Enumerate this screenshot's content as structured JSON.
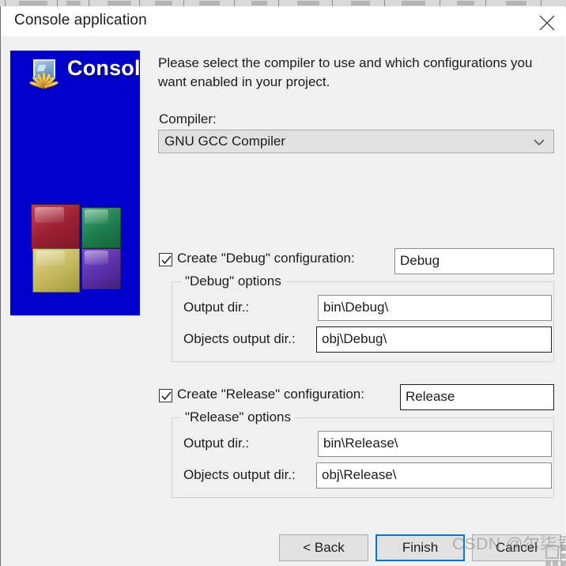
{
  "window": {
    "title": "Console application",
    "close_icon": "close-icon"
  },
  "banner": {
    "title": "Console",
    "icon": "console-picture-fan-icon",
    "background_color": "#0000CC",
    "cubes": [
      {
        "name": "red-cube",
        "color": "#9C1F32"
      },
      {
        "name": "green-cube",
        "color": "#1E7D4C"
      },
      {
        "name": "yellow-cube",
        "color": "#C4B85C"
      },
      {
        "name": "purple-cube",
        "color": "#5A2EA8"
      }
    ]
  },
  "main": {
    "intro": "Please select the compiler to use and which configurations you want enabled in your project.",
    "compiler": {
      "label": "Compiler:",
      "selected": "GNU GCC Compiler",
      "arrow_icon": "chevron-down-icon"
    },
    "debug": {
      "checkbox_checked": true,
      "check_icon": "checkmark-icon",
      "caption": "Create \"Debug\" configuration:",
      "name_value": "Debug",
      "group_title": "\"Debug\" options",
      "output_dir_label": "Output dir.:",
      "output_dir_value": "bin\\Debug\\",
      "objects_dir_label": "Objects output dir.:",
      "objects_dir_value": "obj\\Debug\\"
    },
    "release": {
      "checkbox_checked": true,
      "check_icon": "checkmark-icon",
      "caption": "Create \"Release\" configuration:",
      "name_value": "Release",
      "group_title": "\"Release\" options",
      "output_dir_label": "Output dir.:",
      "output_dir_value": "bin\\Release\\",
      "objects_dir_label": "Objects output dir.:",
      "objects_dir_value": "obj\\Release\\"
    }
  },
  "footer": {
    "back_label": "< Back",
    "finish_label": "Finish",
    "cancel_label": "Cancel",
    "focus_color": "#0078D7"
  },
  "watermark": {
    "text": "CSDN @尔柒君子"
  }
}
